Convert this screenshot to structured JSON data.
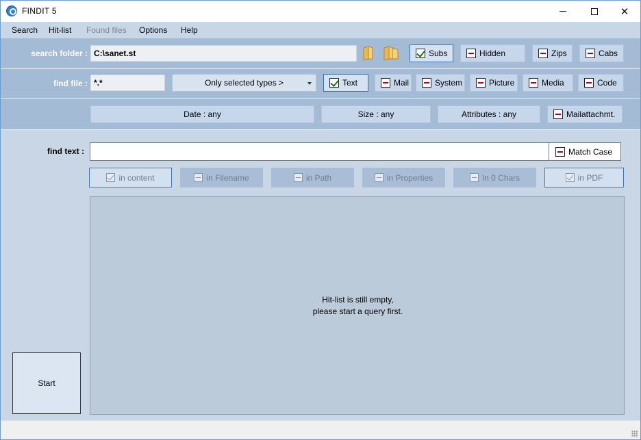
{
  "window": {
    "title": "FINDIT  5"
  },
  "menu": [
    "Search",
    "Hit-list",
    "Found files",
    "Options",
    "Help"
  ],
  "search_folder": {
    "label": "search folder :",
    "value": "C:\\sanet.st",
    "options": [
      {
        "label": "Subs",
        "checked": true
      },
      {
        "label": "Hidden",
        "checked": false
      },
      {
        "label": "Zips",
        "checked": false
      },
      {
        "label": "Cabs",
        "checked": false
      }
    ]
  },
  "find_file": {
    "label": "find file :",
    "value": "*.*",
    "type_select": "Only selected types >",
    "types": [
      {
        "label": "Text",
        "checked": true
      },
      {
        "label": "Mail",
        "checked": false
      },
      {
        "label": "System",
        "checked": false
      },
      {
        "label": "Picture",
        "checked": false
      },
      {
        "label": "Media",
        "checked": false
      },
      {
        "label": "Code",
        "checked": false
      }
    ]
  },
  "filters": {
    "date": "Date : any",
    "size": "Size : any",
    "attributes": "Attributes : any",
    "mailattach": {
      "label": "Mailattachmt.",
      "checked": false
    }
  },
  "find_text": {
    "label": "find text :",
    "value": "",
    "match_case": {
      "label": "Match Case",
      "checked": false
    }
  },
  "search_in": [
    {
      "label": "in content",
      "checked": true,
      "active": true
    },
    {
      "label": "in Filename",
      "checked": false,
      "active": false
    },
    {
      "label": "in Path",
      "checked": false,
      "active": false
    },
    {
      "label": "in Properties",
      "checked": false,
      "active": false
    },
    {
      "label": "In 0 Chars",
      "checked": false,
      "active": false
    },
    {
      "label": "in PDF",
      "checked": true,
      "active": true
    }
  ],
  "hitlist": {
    "message_line1": "Hit-list is still empty,",
    "message_line2": "please start a query first."
  },
  "start_label": "Start"
}
